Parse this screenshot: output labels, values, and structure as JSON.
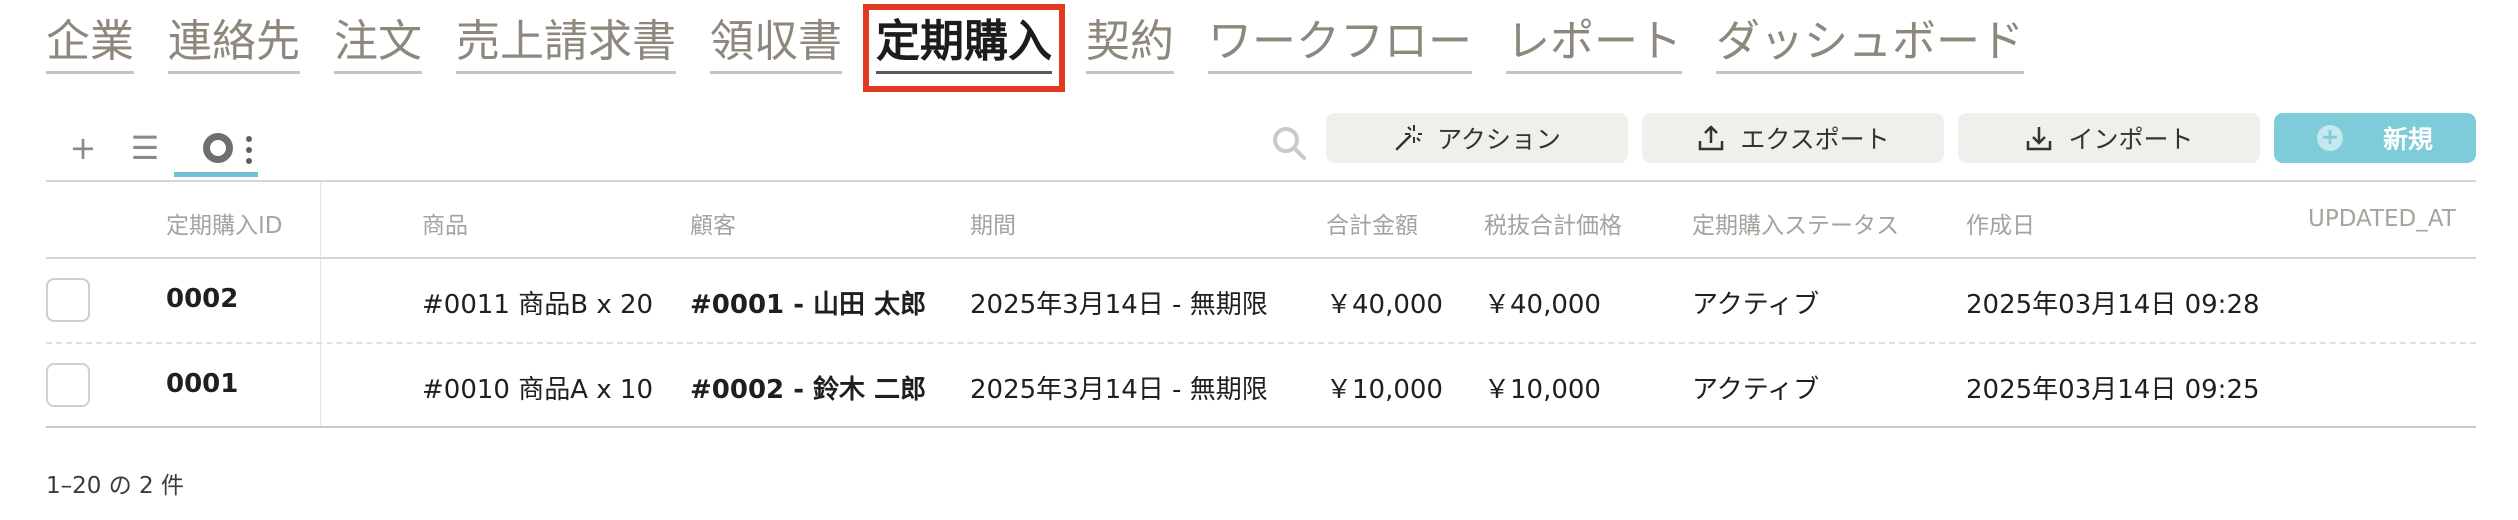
{
  "nav": {
    "items": [
      {
        "label": "企業"
      },
      {
        "label": "連絡先"
      },
      {
        "label": "注文"
      },
      {
        "label": "売上請求書"
      },
      {
        "label": "領収書"
      },
      {
        "label": "定期購入",
        "active": true
      },
      {
        "label": "契約"
      },
      {
        "label": "ワークフロー"
      },
      {
        "label": "レポート"
      },
      {
        "label": "ダッシュボード"
      }
    ]
  },
  "toolbar": {
    "add_icon": "+",
    "list_icon": "☰",
    "action_label": "アクション",
    "export_label": "エクスポート",
    "import_label": "インポート",
    "new_label": "新規"
  },
  "table": {
    "columns": [
      "定期購入ID",
      "商品",
      "顧客",
      "期間",
      "合計金額",
      "税抜合計価格",
      "定期購入ステータス",
      "作成日",
      "UPDATED_AT"
    ],
    "rows": [
      {
        "id": "0002",
        "product": "#0011 商品B x 20",
        "customer": "#0001 - 山田 太郎",
        "period": "2025年3月14日 - 無期限",
        "total": "￥40,000",
        "total_ex_tax": "￥40,000",
        "status": "アクティブ",
        "created": "2025年03月14日 09:28",
        "updated": ""
      },
      {
        "id": "0001",
        "product": "#0010 商品A x 10",
        "customer": "#0002 - 鈴木 二郎",
        "period": "2025年3月14日 - 無期限",
        "total": "￥10,000",
        "total_ex_tax": "￥10,000",
        "status": "アクティブ",
        "created": "2025年03月14日 09:25",
        "updated": ""
      }
    ]
  },
  "footer": {
    "count_text": "1–20 の 2 件"
  },
  "colors": {
    "accent": "#7ecbd9",
    "highlight_frame": "#e23a22",
    "nav_text": "#8d877c"
  }
}
